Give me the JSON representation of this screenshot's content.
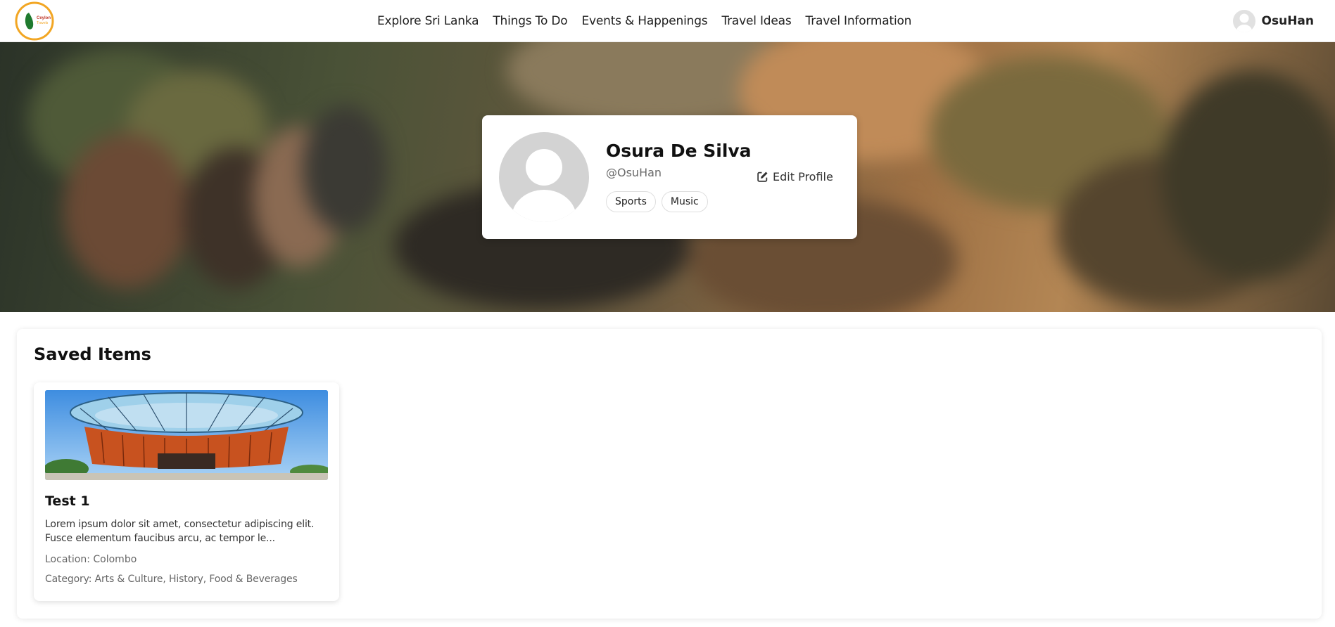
{
  "brand": {
    "logo_text_line1": "Ceylon",
    "logo_text_line2": "Travels"
  },
  "nav": {
    "items": [
      {
        "label": "Explore Sri Lanka"
      },
      {
        "label": "Things To Do"
      },
      {
        "label": "Events & Happenings"
      },
      {
        "label": "Travel Ideas"
      },
      {
        "label": "Travel Information"
      }
    ]
  },
  "user": {
    "username": "OsuHan"
  },
  "profile": {
    "name": "Osura De Silva",
    "handle": "@OsuHan",
    "tags": [
      "Sports",
      "Music"
    ],
    "edit_label": "Edit Profile"
  },
  "saved": {
    "title": "Saved Items",
    "items": [
      {
        "title": "Test 1",
        "description": "Lorem ipsum dolor sit amet, consectetur adipiscing elit. Fusce elementum faucibus arcu, ac tempor le...",
        "location": "Location: Colombo",
        "category": "Category: Arts & Culture, History, Food & Beverages"
      }
    ]
  },
  "colors": {
    "logo_ring": "#f2a623",
    "logo_leaf": "#1f7a2e",
    "avatar_placeholder": "#d3d3d3",
    "building_orange": "#c8521f",
    "sky_blue": "#5a9fe0"
  },
  "icons": {
    "edit": "edit-icon",
    "user": "user-avatar-icon",
    "logo": "logo-icon"
  }
}
